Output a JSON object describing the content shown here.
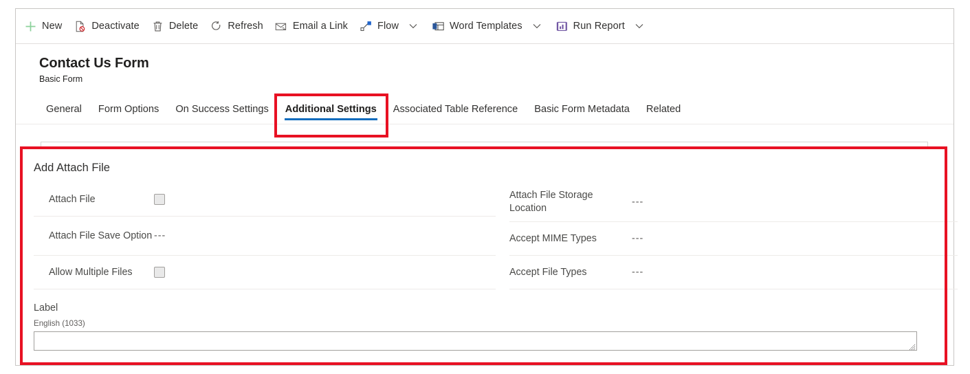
{
  "command_bar": {
    "items": [
      {
        "label": "New",
        "icon": "plus-icon",
        "caret": false
      },
      {
        "label": "Deactivate",
        "icon": "deactivate-icon",
        "caret": false
      },
      {
        "label": "Delete",
        "icon": "trash-icon",
        "caret": false
      },
      {
        "label": "Refresh",
        "icon": "refresh-icon",
        "caret": false
      },
      {
        "label": "Email a Link",
        "icon": "email-link-icon",
        "caret": false
      },
      {
        "label": "Flow",
        "icon": "flow-icon",
        "caret": true
      },
      {
        "label": "Word Templates",
        "icon": "word-template-icon",
        "caret": true
      },
      {
        "label": "Run Report",
        "icon": "run-report-icon",
        "caret": true
      }
    ]
  },
  "header": {
    "title": "Contact Us Form",
    "subtitle": "Basic Form"
  },
  "tabs": [
    {
      "label": "General",
      "active": false
    },
    {
      "label": "Form Options",
      "active": false
    },
    {
      "label": "On Success Settings",
      "active": false
    },
    {
      "label": "Additional Settings",
      "active": true
    },
    {
      "label": "Associated Table Reference",
      "active": false
    },
    {
      "label": "Basic Form Metadata",
      "active": false
    },
    {
      "label": "Related",
      "active": false
    }
  ],
  "section": {
    "title": "Add Attach File",
    "left_fields": [
      {
        "label": "Attach File",
        "type": "checkbox",
        "value": ""
      },
      {
        "label": "Attach File Save Option",
        "type": "text",
        "value": "---"
      },
      {
        "label": "Allow Multiple Files",
        "type": "checkbox",
        "value": ""
      }
    ],
    "right_fields": [
      {
        "label": "Attach File Storage Location",
        "type": "text",
        "value": "---"
      },
      {
        "label": "Accept MIME Types",
        "type": "text",
        "value": "---"
      },
      {
        "label": "Accept File Types",
        "type": "text",
        "value": "---"
      }
    ],
    "label_block": {
      "heading": "Label",
      "language": "English (1033)",
      "value": "",
      "placeholder": ""
    }
  },
  "colors": {
    "annotation_red": "#e81123",
    "active_tab_underline": "#0f6cbd",
    "new_icon_green": "#8cd19b",
    "flow_icon_blue": "#2266cc",
    "report_icon_purple": "#6b4fa0",
    "delete_icon_red": "#d13438"
  }
}
